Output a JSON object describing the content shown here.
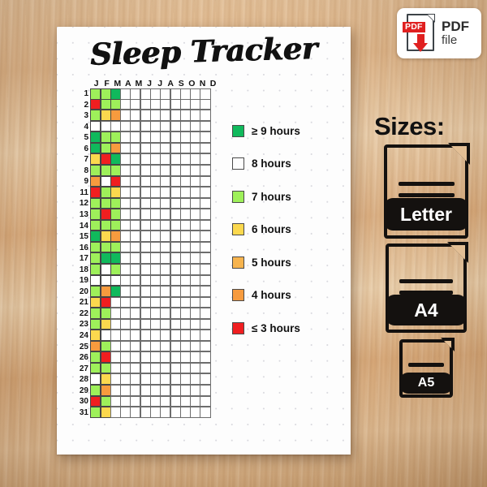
{
  "product": {
    "title": "Sleep Tracker"
  },
  "badge": {
    "icon": "pdf-document-icon",
    "tag": "PDF",
    "line1": "PDF",
    "line2": "file"
  },
  "sizes": {
    "heading": "Sizes:",
    "options": [
      {
        "label": "Letter",
        "icon": "document-icon"
      },
      {
        "label": "A4",
        "icon": "document-icon"
      },
      {
        "label": "A5",
        "icon": "document-icon"
      }
    ]
  },
  "tracker": {
    "month_headers": [
      "J",
      "F",
      "M",
      "A",
      "M",
      "J",
      "J",
      "A",
      "S",
      "O",
      "N",
      "D"
    ],
    "row_labels": [
      "1",
      "2",
      "3",
      "4",
      "5",
      "6",
      "7",
      "8",
      "9",
      "11",
      "12",
      "13",
      "14",
      "15",
      "16",
      "17",
      "18",
      "19",
      "20",
      "21",
      "22",
      "23",
      "24",
      "25",
      "26",
      "27",
      "28",
      "29",
      "30",
      "31"
    ],
    "columns": 12,
    "empty_color": "#ffffff",
    "rows": [
      [
        "#9EF05A",
        "#9EF05A",
        "#10B95C",
        "",
        "",
        "",
        "",
        "",
        "",
        "",
        "",
        ""
      ],
      [
        "#F01E20",
        "#9EF05A",
        "#9EF05A",
        "",
        "",
        "",
        "",
        "",
        "",
        "",
        "",
        ""
      ],
      [
        "#9EF05A",
        "#FBD84E",
        "#F79B3E",
        "",
        "",
        "",
        "",
        "",
        "",
        "",
        "",
        ""
      ],
      [
        "#62C martinez",
        "",
        "",
        "",
        "",
        "",
        "",
        "",
        "",
        "",
        "",
        ""
      ],
      [
        "#10B95C",
        "#9EF05A",
        "#9EF05A",
        "",
        "",
        "",
        "",
        "",
        "",
        "",
        "",
        ""
      ],
      [
        "#10B95C",
        "#9EF05A",
        "#F79B3E",
        "",
        "",
        "",
        "",
        "",
        "",
        "",
        "",
        ""
      ],
      [
        "#FBD84E",
        "#F01E20",
        "#10B95C",
        "",
        "",
        "",
        "",
        "",
        "",
        "",
        "",
        ""
      ],
      [
        "#9EF05A",
        "#9EF05A",
        "#9EF05A",
        "",
        "",
        "",
        "",
        "",
        "",
        "",
        "",
        ""
      ],
      [
        "#F79B3E",
        "#62C martinez",
        "#F01E20",
        "",
        "",
        "",
        "",
        "",
        "",
        "",
        "",
        ""
      ],
      [
        "#F01E20",
        "#9EF05A",
        "#FBD84E",
        "",
        "",
        "",
        "",
        "",
        "",
        "",
        "",
        ""
      ],
      [
        "#9EF05A",
        "#9EF05A",
        "#9EF05A",
        "",
        "",
        "",
        "",
        "",
        "",
        "",
        "",
        ""
      ],
      [
        "#9EF05A",
        "#F01E20",
        "#9EF05A",
        "",
        "",
        "",
        "",
        "",
        "",
        "",
        "",
        ""
      ],
      [
        "#9EF05A",
        "#9EF05A",
        "#9EF05A",
        "",
        "",
        "",
        "",
        "",
        "",
        "",
        "",
        ""
      ],
      [
        "#10B95C",
        "#FBD84E",
        "#F79B3E",
        "",
        "",
        "",
        "",
        "",
        "",
        "",
        "",
        ""
      ],
      [
        "#9EF05A",
        "#9EF05A",
        "#9EF05A",
        "",
        "",
        "",
        "",
        "",
        "",
        "",
        "",
        ""
      ],
      [
        "#9EF05A",
        "#10B95C",
        "#10B95C",
        "",
        "",
        "",
        "",
        "",
        "",
        "",
        "",
        ""
      ],
      [
        "#9EF05A",
        "#62C martinez",
        "#9EF05A",
        "",
        "",
        "",
        "",
        "",
        "",
        "",
        "",
        ""
      ],
      [
        "#62C martinez",
        "#62C martinez",
        "#62C martinez",
        "",
        "",
        "",
        "",
        "",
        "",
        "",
        "",
        ""
      ],
      [
        "#9EF05A",
        "#F79B3E",
        "#10B95C",
        "",
        "",
        "",
        "",
        "",
        "",
        "",
        "",
        ""
      ],
      [
        "#FBD84E",
        "#F01E20",
        "",
        "",
        "",
        "",
        "",
        "",
        "",
        "",
        "",
        ""
      ],
      [
        "#9EF05A",
        "#9EF05A",
        "",
        "",
        "",
        "",
        "",
        "",
        "",
        "",
        "",
        ""
      ],
      [
        "#9EF05A",
        "#FBD84E",
        "",
        "",
        "",
        "",
        "",
        "",
        "",
        "",
        "",
        ""
      ],
      [
        "#FBD84E",
        "#62C martinez",
        "",
        "",
        "",
        "",
        "",
        "",
        "",
        "",
        "",
        ""
      ],
      [
        "#F79B3E",
        "#9EF05A",
        "",
        "",
        "",
        "",
        "",
        "",
        "",
        "",
        "",
        ""
      ],
      [
        "#9EF05A",
        "#F01E20",
        "",
        "",
        "",
        "",
        "",
        "",
        "",
        "",
        "",
        ""
      ],
      [
        "#9EF05A",
        "#9EF05A",
        "",
        "",
        "",
        "",
        "",
        "",
        "",
        "",
        "",
        ""
      ],
      [
        "#62C martinez",
        "#FBD84E",
        "",
        "",
        "",
        "",
        "",
        "",
        "",
        "",
        "",
        ""
      ],
      [
        "#9EF05A",
        "#F79B3E",
        "",
        "",
        "",
        "",
        "",
        "",
        "",
        "",
        "",
        ""
      ],
      [
        "#F01E20",
        "#9EF05A",
        "",
        "",
        "",
        "",
        "",
        "",
        "",
        "",
        "",
        ""
      ],
      [
        "#9EF05A",
        "#FBD84E",
        "",
        "",
        "",
        "",
        "",
        "",
        "",
        "",
        "",
        ""
      ],
      [
        "#62C martinez",
        "#9EF05A",
        "",
        "",
        "",
        "",
        "",
        "",
        "",
        "",
        "",
        ""
      ]
    ]
  },
  "legend": {
    "items": [
      {
        "color": "#10B95C",
        "label": "≥ 9 hours"
      },
      {
        "color": "#62C martinez",
        "label": "8 hours"
      },
      {
        "color": "#9EF05A",
        "label": "7 hours"
      },
      {
        "color": "#FBD84E",
        "label": "6 hours"
      },
      {
        "color": "#F7B44E",
        "label": "5 hours"
      },
      {
        "color": "#F79B3E",
        "label": "4 hours"
      },
      {
        "color": "#F01E20",
        "label": "≤ 3 hours"
      }
    ]
  }
}
